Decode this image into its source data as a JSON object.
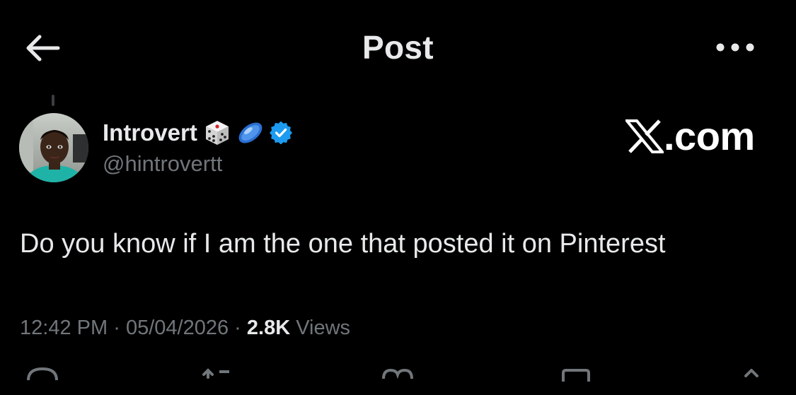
{
  "header": {
    "title": "Post"
  },
  "author": {
    "name": "Introvert",
    "handle": "@hintrovertt",
    "badges": [
      "dice-emoji",
      "flying-disc-emoji",
      "verified-badge-icon"
    ]
  },
  "watermark": {
    "text": ".com",
    "logo": "x-logo-icon"
  },
  "post": {
    "text": "Do you know if I am the one that posted it on Pinterest"
  },
  "meta": {
    "time": "12:42 PM",
    "date": "05/04/2026",
    "views_count": "2.8K",
    "views_label": "Views",
    "separator": "·"
  },
  "actions": [
    "reply-icon",
    "repost-icon",
    "like-icon",
    "bookmark-icon",
    "share-icon"
  ],
  "colors": {
    "background": "#000000",
    "primary_text": "#e7e9ea",
    "secondary_text": "#71767b",
    "verified": "#1d9bf0"
  }
}
